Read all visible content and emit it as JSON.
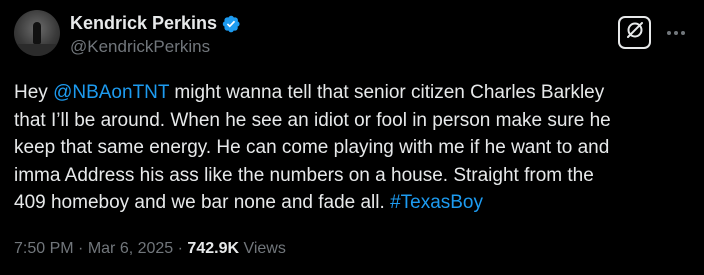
{
  "author": {
    "display_name": "Kendrick Perkins",
    "handle": "@KendrickPerkins",
    "verified": true
  },
  "tweet": {
    "lines": [
      {
        "pre": "Hey ",
        "mention": "@NBAonTNT",
        "post": " might wanna tell that senior citizen Charles Barkley"
      },
      {
        "text": "that I’ll be around. When he see an idiot or fool in person make sure he"
      },
      {
        "text": "keep that same energy. He can come playing with me if he want to and"
      },
      {
        "text": "imma Address his ass like the numbers on a house. Straight from the"
      },
      {
        "pre": "409 homeboy and we bar none and fade all. ",
        "hashtag": "#TexasBoy"
      }
    ]
  },
  "meta": {
    "time": "7:50 PM",
    "sep1": " · ",
    "date": "Mar 6, 2025",
    "sep2": " · ",
    "views_count": "742.9K",
    "views_label": " Views"
  },
  "icons": {
    "verified": "verified-badge-icon",
    "grok": "grok-icon",
    "more": "more-dots-icon"
  },
  "colors": {
    "background": "#000000",
    "text": "#e7e9ea",
    "secondary": "#71767b",
    "link": "#1d9bf0"
  }
}
